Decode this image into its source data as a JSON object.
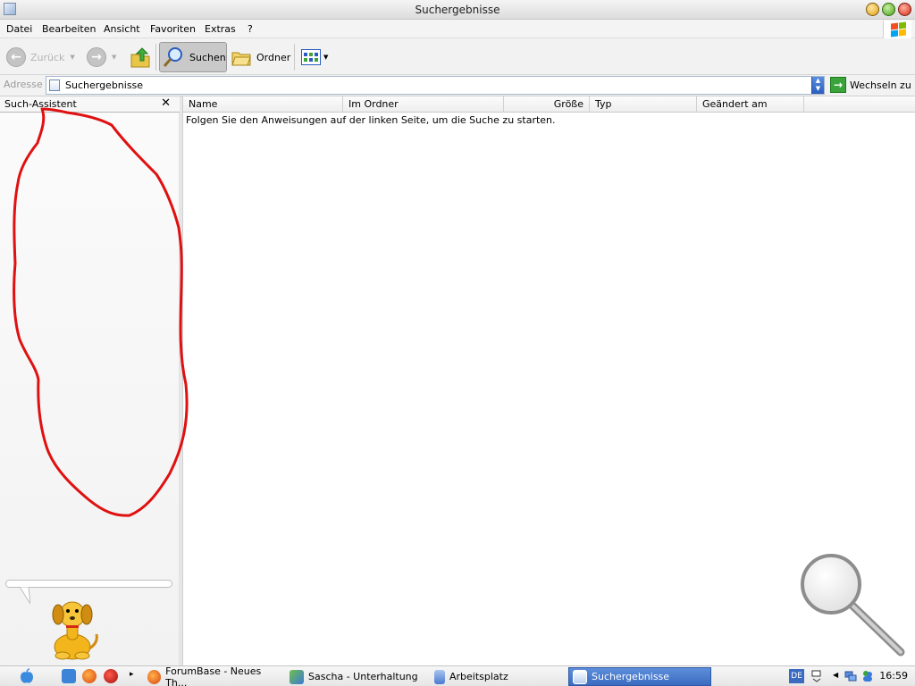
{
  "window": {
    "title": "Suchergebnisse",
    "icon": "search-results-window-icon"
  },
  "menu": {
    "items": [
      "Datei",
      "Bearbeiten",
      "Ansicht",
      "Favoriten",
      "Extras",
      "?"
    ]
  },
  "toolbar": {
    "back_label": "Zurück",
    "forward_label": "",
    "search_label": "Suchen",
    "folders_label": "Ordner",
    "icons": [
      "back-arrow-icon",
      "forward-arrow-icon",
      "folder-up-icon",
      "search-magnifier-icon",
      "folders-icon",
      "views-icon"
    ]
  },
  "address": {
    "label": "Adresse",
    "value": "Suchergebnisse",
    "go_label": "Wechseln zu"
  },
  "search_panel": {
    "title": "Such-Assistent",
    "close_symbol": "✕"
  },
  "results": {
    "columns": [
      "Name",
      "Im Ordner",
      "Größe",
      "Typ",
      "Geändert am"
    ],
    "message": "Folgen Sie den Anweisungen auf der linken Seite, um die Suche zu starten."
  },
  "taskbar": {
    "tasks": [
      {
        "label": "ForumBase - Neues Th...",
        "icon": "firefox-icon",
        "active": false
      },
      {
        "label": "Sascha - Unterhaltung",
        "icon": "messenger-icon",
        "active": false
      },
      {
        "label": "Arbeitsplatz",
        "icon": "computer-icon",
        "active": false
      },
      {
        "label": "Suchergebnisse",
        "icon": "search-results-icon",
        "active": true
      }
    ],
    "language": "DE",
    "clock": "16:59"
  },
  "colors": {
    "accent": "#3a6bc0",
    "annotation_red": "#e01010",
    "go_green": "#3aa43a"
  }
}
